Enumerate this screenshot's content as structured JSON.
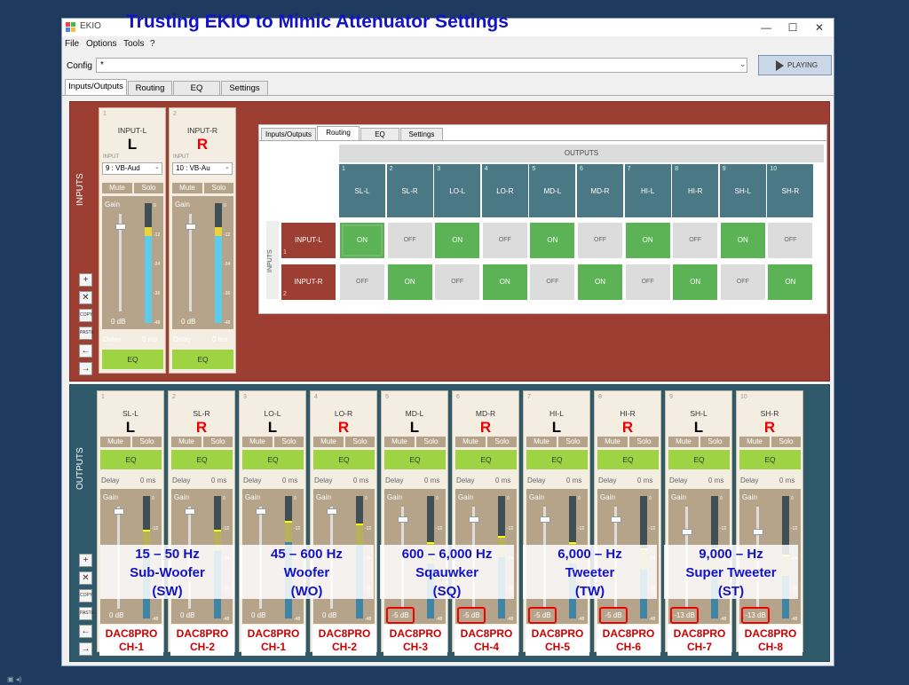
{
  "window": {
    "title": "EKIO",
    "minimize": "—",
    "maximize": "☐",
    "close": "✕"
  },
  "headline": "Trusting EKIO to Mimic Attenuator Settings",
  "menu": [
    "File",
    "Options",
    "Tools",
    "?"
  ],
  "config": {
    "label": "Config",
    "value": "*",
    "play_label": "PLAYING"
  },
  "tabs": [
    "Inputs/Outputs",
    "Routing",
    "EQ",
    "Settings"
  ],
  "active_tab": "Inputs/Outputs",
  "inputs": {
    "section_label": "INPUTS",
    "side_buttons": [
      "+",
      "✕",
      "COPY",
      "PASTE",
      "←",
      "→"
    ],
    "strips": [
      {
        "num": "1",
        "name": "INPUT-L",
        "big": "L",
        "color": "black",
        "input_label": "INPUT",
        "device": "9 : VB-Aud",
        "mute": "Mute",
        "solo": "Solo",
        "gain": "Gain",
        "db": "0 dB",
        "delay": "Delay",
        "delay_value": "0 ms",
        "eq": "EQ",
        "level": 0.8
      },
      {
        "num": "2",
        "name": "INPUT-R",
        "big": "R",
        "color": "red",
        "input_label": "INPUT",
        "device": "10 : VB-Au",
        "mute": "Mute",
        "solo": "Solo",
        "gain": "Gain",
        "db": "0 dB",
        "delay": "Delay",
        "delay_value": "0 ms",
        "eq": "EQ",
        "level": 0.8
      }
    ],
    "scale": [
      "0",
      "-12",
      "-24",
      "-36",
      "-48"
    ]
  },
  "routing": {
    "tabs": [
      "Inputs/Outputs",
      "Routing",
      "EQ",
      "Settings"
    ],
    "active_tab": "Routing",
    "outputs_label": "OUTPUTS",
    "inputs_label": "INPUTS",
    "columns": [
      {
        "num": "1",
        "name": "SL-L"
      },
      {
        "num": "2",
        "name": "SL-R"
      },
      {
        "num": "3",
        "name": "LO-L"
      },
      {
        "num": "4",
        "name": "LO-R"
      },
      {
        "num": "5",
        "name": "MD-L"
      },
      {
        "num": "6",
        "name": "MD-R"
      },
      {
        "num": "7",
        "name": "HI-L"
      },
      {
        "num": "8",
        "name": "HI-R"
      },
      {
        "num": "9",
        "name": "SH-L"
      },
      {
        "num": "10",
        "name": "SH-R"
      }
    ],
    "rows": [
      {
        "num": "1",
        "name": "INPUT-L",
        "cells": [
          "ON",
          "OFF",
          "ON",
          "OFF",
          "ON",
          "OFF",
          "ON",
          "OFF",
          "ON",
          "OFF"
        ]
      },
      {
        "num": "2",
        "name": "INPUT-R",
        "cells": [
          "OFF",
          "ON",
          "OFF",
          "ON",
          "OFF",
          "ON",
          "OFF",
          "ON",
          "OFF",
          "ON"
        ]
      }
    ]
  },
  "outputs": {
    "section_label": "OUTPUTS",
    "side_buttons": [
      "+",
      "✕",
      "COPY",
      "PASTE",
      "←",
      "→"
    ],
    "strips": [
      {
        "num": "1",
        "name": "SL-L",
        "big": "L",
        "color": "black",
        "db": "0 dB",
        "level": 0.55
      },
      {
        "num": "2",
        "name": "SL-R",
        "big": "R",
        "color": "red",
        "db": "0 dB",
        "level": 0.55
      },
      {
        "num": "3",
        "name": "LO-L",
        "big": "L",
        "color": "black",
        "db": "0 dB",
        "level": 0.62
      },
      {
        "num": "4",
        "name": "LO-R",
        "big": "R",
        "color": "red",
        "db": "0 dB",
        "level": 0.6
      },
      {
        "num": "5",
        "name": "MD-L",
        "big": "L",
        "color": "black",
        "db": "-5 dB",
        "level": 0.45
      },
      {
        "num": "6",
        "name": "MD-R",
        "big": "R",
        "color": "red",
        "db": "-5 dB",
        "level": 0.5
      },
      {
        "num": "7",
        "name": "HI-L",
        "big": "L",
        "color": "black",
        "db": "-5 dB",
        "level": 0.45
      },
      {
        "num": "8",
        "name": "HI-R",
        "big": "R",
        "color": "red",
        "db": "-5 dB",
        "level": 0.4
      },
      {
        "num": "9",
        "name": "SH-L",
        "big": "L",
        "color": "black",
        "db": "-13 dB",
        "level": 0.4
      },
      {
        "num": "10",
        "name": "SH-R",
        "big": "R",
        "color": "red",
        "db": "-13 dB",
        "level": 0.35
      }
    ],
    "labels": {
      "mute": "Mute",
      "solo": "Solo",
      "eq": "EQ",
      "delay": "Delay",
      "delay_value": "0 ms",
      "gain": "Gain"
    },
    "scale": [
      "0",
      "-12",
      "-24",
      "-36",
      "-48"
    ]
  },
  "annotations": [
    {
      "lines": [
        "15 – 50 Hz",
        "Sub-Woofer",
        "(SW)"
      ]
    },
    {
      "lines": [
        "45 – 600 Hz",
        "Woofer",
        "(WO)"
      ]
    },
    {
      "lines": [
        "600 – 6,000 Hz",
        "Sqauwker",
        "(SQ)"
      ]
    },
    {
      "lines": [
        "6,000 –  Hz",
        "Tweeter",
        "(TW)"
      ]
    },
    {
      "lines": [
        "9,000 –   Hz",
        "Super Tweeter",
        "(ST)"
      ]
    }
  ],
  "dac_labels": [
    {
      "top": "DAC8PRO",
      "bottom": "CH-1"
    },
    {
      "top": "DAC8PRO",
      "bottom": "CH-2"
    },
    {
      "top": "DAC8PRO",
      "bottom": "CH-1"
    },
    {
      "top": "DAC8PRO",
      "bottom": "CH-2"
    },
    {
      "top": "DAC8PRO",
      "bottom": "CH-3"
    },
    {
      "top": "DAC8PRO",
      "bottom": "CH-4"
    },
    {
      "top": "DAC8PRO",
      "bottom": "CH-5"
    },
    {
      "top": "DAC8PRO",
      "bottom": "CH-6"
    },
    {
      "top": "DAC8PRO",
      "bottom": "CH-7"
    },
    {
      "top": "DAC8PRO",
      "bottom": "CH-8"
    }
  ],
  "colors": {
    "accent_on": "#5bb355",
    "input_panel": "#9c3e32",
    "output_panel": "#2f5a6c",
    "eq_green": "#9ed444",
    "headline": "#1212c8"
  }
}
